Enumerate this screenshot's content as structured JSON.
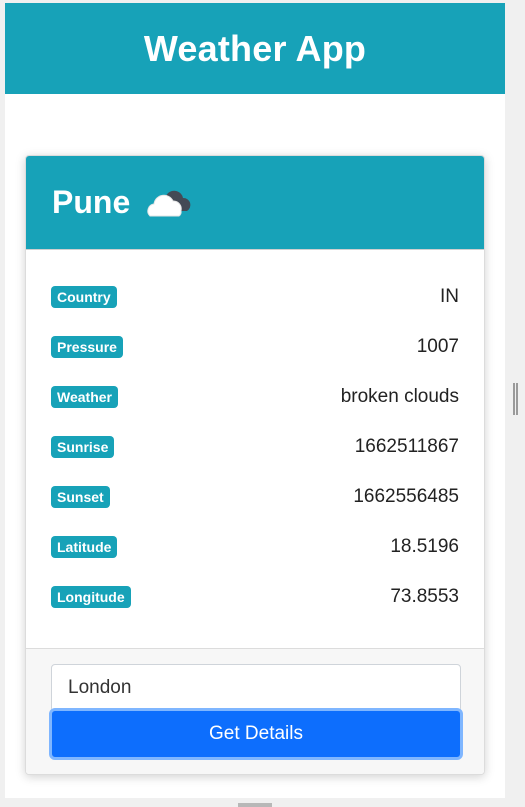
{
  "header": {
    "title": "Weather App"
  },
  "card": {
    "city": "Pune",
    "icon": "cloud-icon",
    "details": [
      {
        "label": "Country",
        "value": "IN"
      },
      {
        "label": "Pressure",
        "value": "1007"
      },
      {
        "label": "Weather",
        "value": "broken clouds"
      },
      {
        "label": "Sunrise",
        "value": "1662511867"
      },
      {
        "label": "Sunset",
        "value": "1662556485"
      },
      {
        "label": "Latitude",
        "value": "18.5196"
      },
      {
        "label": "Longitude",
        "value": "73.8553"
      }
    ]
  },
  "form": {
    "city_value": "London",
    "button_label": "Get Details"
  },
  "colors": {
    "accent": "#17a2b8",
    "primary_button": "#0d6efd"
  }
}
